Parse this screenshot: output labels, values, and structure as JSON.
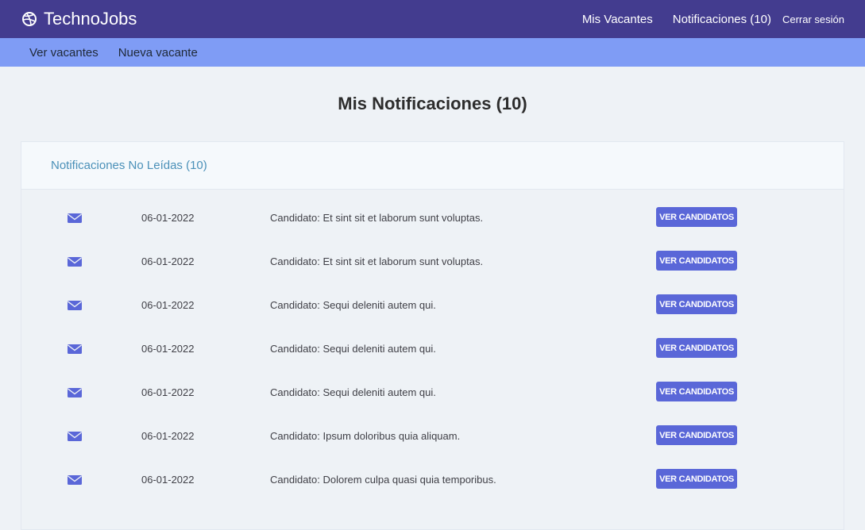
{
  "brand": {
    "name": "TechnoJobs",
    "icon": "dribbble-globe-icon"
  },
  "topnav": {
    "vacantes": "Mis Vacantes",
    "notificaciones": "Notificaciones (10)",
    "logout": "Cerrar sesión"
  },
  "subnav": {
    "ver_vacantes": "Ver vacantes",
    "nueva_vacante": "Nueva vacante"
  },
  "page": {
    "title": "Mis Notificaciones (10)"
  },
  "panel": {
    "header": "Notificaciones No Leídas (10)"
  },
  "notifications": [
    {
      "date": "06-01-2022",
      "message": "Candidato: Et sint sit et laborum sunt voluptas.",
      "button": "VER CANDIDATOS"
    },
    {
      "date": "06-01-2022",
      "message": "Candidato: Et sint sit et laborum sunt voluptas.",
      "button": "VER CANDIDATOS"
    },
    {
      "date": "06-01-2022",
      "message": "Candidato: Sequi deleniti autem qui.",
      "button": "VER CANDIDATOS"
    },
    {
      "date": "06-01-2022",
      "message": "Candidato: Sequi deleniti autem qui.",
      "button": "VER CANDIDATOS"
    },
    {
      "date": "06-01-2022",
      "message": "Candidato: Sequi deleniti autem qui.",
      "button": "VER CANDIDATOS"
    },
    {
      "date": "06-01-2022",
      "message": "Candidato: Ipsum doloribus quia aliquam.",
      "button": "VER CANDIDATOS"
    },
    {
      "date": "06-01-2022",
      "message": "Candidato: Dolorem culpa quasi quia temporibus.",
      "button": "VER CANDIDATOS"
    }
  ],
  "colors": {
    "topbar": "#433c8f",
    "subbar": "#7f9cf5",
    "accent": "#5a67d8",
    "panel_header_text": "#4a90b8"
  }
}
